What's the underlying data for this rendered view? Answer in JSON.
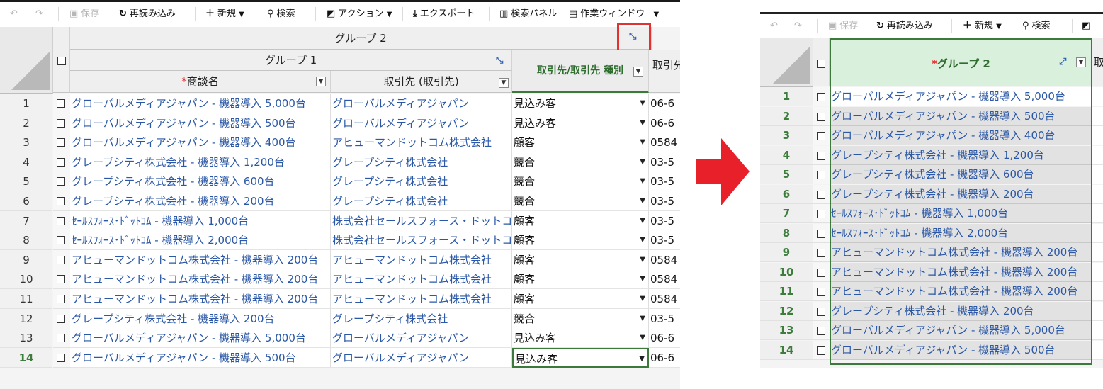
{
  "toolbar": {
    "undo_icon": "undo-icon",
    "redo_icon": "redo-icon",
    "save_label": "保存",
    "reload_label": "再読み込み",
    "new_label": "新規",
    "search_label": "検索",
    "action_label": "アクション",
    "export_label": "エクスポート",
    "search_panel_label": "検索パネル",
    "work_window_label": "作業ウィンドウ"
  },
  "left": {
    "group2_label": "グループ 2",
    "group1_label": "グループ 1",
    "col_deal_label": "商談名",
    "col_account_label": "取引先 (取引先)",
    "col_type_label": "取引先/取引先 種別",
    "col_next_label": "取引先",
    "required_mark": "*",
    "rows": [
      {
        "n": "1",
        "deal": "グローバルメディアジャパン - 機器導入 5,000台",
        "account": "グローバルメディアジャパン",
        "type": "見込み客",
        "phone": "06-6"
      },
      {
        "n": "2",
        "deal": "グローバルメディアジャパン - 機器導入 500台",
        "account": "グローバルメディアジャパン",
        "type": "見込み客",
        "phone": "06-6"
      },
      {
        "n": "3",
        "deal": "グローバルメディアジャパン - 機器導入 400台",
        "account": "アヒューマンドットコム株式会社",
        "type": "顧客",
        "phone": "0584"
      },
      {
        "n": "4",
        "deal": "グレープシティ株式会社 - 機器導入 1,200台",
        "account": "グレープシティ株式会社",
        "type": "競合",
        "phone": "03-5"
      },
      {
        "n": "5",
        "deal": "グレープシティ株式会社 - 機器導入 600台",
        "account": "グレープシティ株式会社",
        "type": "競合",
        "phone": "03-5"
      },
      {
        "n": "6",
        "deal": "グレープシティ株式会社 - 機器導入 200台",
        "account": "グレープシティ株式会社",
        "type": "競合",
        "phone": "03-5"
      },
      {
        "n": "7",
        "deal": "ｾｰﾙｽﾌｫｰｽ･ﾄﾞｯﾄｺﾑ - 機器導入 1,000台",
        "account": "株式会社セールスフォース・ドットコム",
        "type": "顧客",
        "phone": "03-5"
      },
      {
        "n": "8",
        "deal": "ｾｰﾙｽﾌｫｰｽ･ﾄﾞｯﾄｺﾑ - 機器導入 2,000台",
        "account": "株式会社セールスフォース・ドットコム",
        "type": "顧客",
        "phone": "03-5"
      },
      {
        "n": "9",
        "deal": "アヒューマンドットコム株式会社 - 機器導入 200台",
        "account": "アヒューマンドットコム株式会社",
        "type": "顧客",
        "phone": "0584"
      },
      {
        "n": "10",
        "deal": "アヒューマンドットコム株式会社 - 機器導入 200台",
        "account": "アヒューマンドットコム株式会社",
        "type": "顧客",
        "phone": "0584"
      },
      {
        "n": "11",
        "deal": "アヒューマンドットコム株式会社 - 機器導入 200台",
        "account": "アヒューマンドットコム株式会社",
        "type": "顧客",
        "phone": "0584"
      },
      {
        "n": "12",
        "deal": "グレープシティ株式会社 - 機器導入 200台",
        "account": "グレープシティ株式会社",
        "type": "競合",
        "phone": "03-5"
      },
      {
        "n": "13",
        "deal": "グローバルメディアジャパン - 機器導入 5,000台",
        "account": "グローバルメディアジャパン",
        "type": "見込み客",
        "phone": "06-6"
      },
      {
        "n": "14",
        "deal": "グローバルメディアジャパン - 機器導入 500台",
        "account": "グローバルメディアジャパン",
        "type": "見込み客",
        "phone": "06-6"
      }
    ]
  },
  "right": {
    "group2_label": "グループ 2",
    "required_mark": "*",
    "next_header_char": "取",
    "rows": [
      {
        "n": "1",
        "deal": "グローバルメディアジャパン - 機器導入 5,000台"
      },
      {
        "n": "2",
        "deal": "グローバルメディアジャパン - 機器導入 500台"
      },
      {
        "n": "3",
        "deal": "グローバルメディアジャパン - 機器導入 400台"
      },
      {
        "n": "4",
        "deal": "グレープシティ株式会社 - 機器導入 1,200台"
      },
      {
        "n": "5",
        "deal": "グレープシティ株式会社 - 機器導入 600台"
      },
      {
        "n": "6",
        "deal": "グレープシティ株式会社 - 機器導入 200台"
      },
      {
        "n": "7",
        "deal": "ｾｰﾙｽﾌｫｰｽ･ﾄﾞｯﾄｺﾑ - 機器導入 1,000台"
      },
      {
        "n": "8",
        "deal": "ｾｰﾙｽﾌｫｰｽ･ﾄﾞｯﾄｺﾑ - 機器導入 2,000台"
      },
      {
        "n": "9",
        "deal": "アヒューマンドットコム株式会社 - 機器導入 200台"
      },
      {
        "n": "10",
        "deal": "アヒューマンドットコム株式会社 - 機器導入 200台"
      },
      {
        "n": "11",
        "deal": "アヒューマンドットコム株式会社 - 機器導入 200台"
      },
      {
        "n": "12",
        "deal": "グレープシティ株式会社 - 機器導入 200台"
      },
      {
        "n": "13",
        "deal": "グローバルメディアジャパン - 機器導入 5,000台"
      },
      {
        "n": "14",
        "deal": "グローバルメディアジャパン - 機器導入 500台"
      }
    ]
  },
  "colors": {
    "link": "#2a57a6",
    "active_green": "#3b7a3b",
    "highlight_red": "#e53030",
    "arrow_red": "#e8202a"
  }
}
